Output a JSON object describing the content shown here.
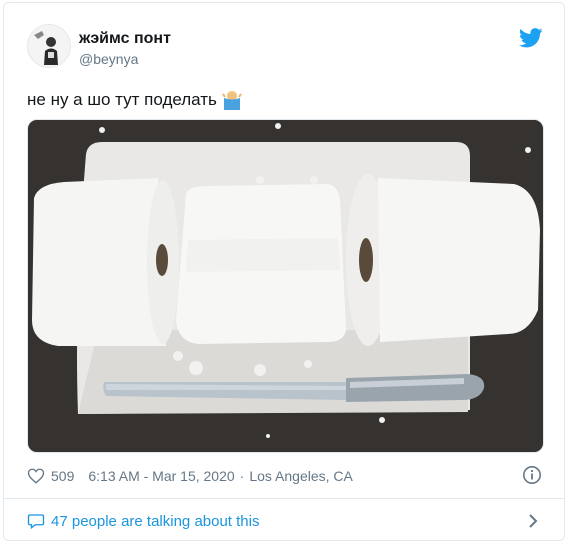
{
  "author": {
    "name": "жэймс понт",
    "handle": "@beynya"
  },
  "tweet": {
    "text": "не ну а шо тут поделать",
    "emoji": "person-shrugging-emoji"
  },
  "media": {
    "description_icon": "photo"
  },
  "meta": {
    "likes": "509",
    "timestamp": "6:13 AM - Mar 15, 2020",
    "separator": "·",
    "location": "Los Angeles, CA"
  },
  "discussion": {
    "label": "47 people are talking about this"
  },
  "colors": {
    "twitter_blue": "#1da1f2",
    "link_blue": "#1b95e0",
    "muted": "#657786",
    "text": "#14171a",
    "border": "#e1e8ed"
  },
  "icons": [
    "twitter-bird-icon",
    "heart-icon",
    "info-icon",
    "speech-bubble-icon",
    "chevron-right-icon"
  ]
}
